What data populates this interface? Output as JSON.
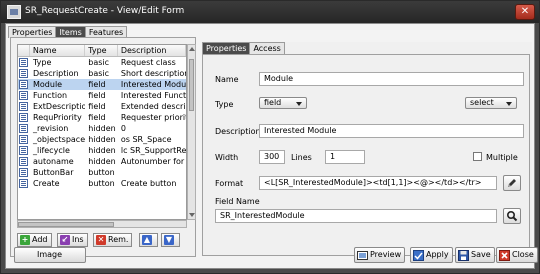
{
  "window": {
    "title": "SR_RequestCreate - View/Edit Form",
    "close_glyph": "✕"
  },
  "tabs": [
    {
      "label": "Properties",
      "active": false
    },
    {
      "label": "Items",
      "active": true
    },
    {
      "label": "Features",
      "active": false
    }
  ],
  "grid": {
    "headers": [
      "Name",
      "Type",
      "Description"
    ],
    "rows": [
      {
        "name": "Type",
        "type": "basic",
        "desc": "Request class",
        "selected": false
      },
      {
        "name": "Description",
        "type": "basic",
        "desc": "Short description",
        "selected": false
      },
      {
        "name": "Module",
        "type": "field",
        "desc": "Interested Module",
        "selected": true
      },
      {
        "name": "Function",
        "type": "field",
        "desc": "Interested Function",
        "selected": false
      },
      {
        "name": "ExtDescription",
        "type": "field",
        "desc": "Extended description",
        "selected": false
      },
      {
        "name": "RequPriority",
        "type": "field",
        "desc": "Requester priority",
        "selected": false
      },
      {
        "name": "_revision",
        "type": "hidden",
        "desc": "0",
        "selected": false
      },
      {
        "name": "_objectspace",
        "type": "hidden",
        "desc": "os SR_Space",
        "selected": false
      },
      {
        "name": "_lifecycle",
        "type": "hidden",
        "desc": "lc SR_SupportRequest",
        "selected": false
      },
      {
        "name": "autoname",
        "type": "hidden",
        "desc": "Autonumber for",
        "selected": false
      },
      {
        "name": "ButtonBar",
        "type": "button",
        "desc": "",
        "selected": false
      },
      {
        "name": "Create",
        "type": "button",
        "desc": "Create button",
        "selected": false
      }
    ]
  },
  "list_toolbar": {
    "add": "Add",
    "ins": "Ins",
    "rem": "Rem.",
    "up_icon": "arrow-up-icon",
    "down_icon": "arrow-down-icon"
  },
  "right_tabs": [
    {
      "label": "Properties",
      "active": true
    },
    {
      "label": "Access",
      "active": false
    }
  ],
  "form": {
    "name_label": "Name",
    "name_value": "Module",
    "type_label": "Type",
    "type_value": "field",
    "select_value": "select",
    "description_label": "Description",
    "description_value": "Interested Module",
    "width_label": "Width",
    "width_value": "300",
    "lines_label": "Lines",
    "lines_value": "1",
    "multiple_label": "Multiple",
    "multiple_checked": false,
    "format_label": "Format",
    "format_value": "<L[SR_InterestedModule]><td[1,1]><@></td></tr>",
    "field_name_label": "Field Name",
    "field_name_value": "SR_InterestedModule"
  },
  "bottom_buttons": {
    "image": "Image",
    "preview": "Preview",
    "apply": "Apply",
    "save": "Save",
    "close": "Close"
  },
  "colors": {
    "selection": "#bcd4f0",
    "active_tab": "#4b4b4b",
    "add_green": "#3aa53a",
    "remove_red": "#d03a2a"
  }
}
